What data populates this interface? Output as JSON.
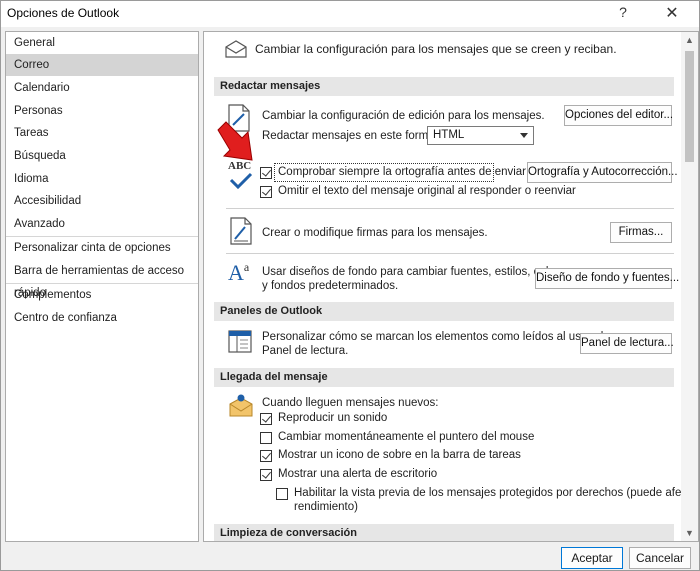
{
  "window": {
    "title": "Opciones de Outlook",
    "help_glyph": "?",
    "close_glyph": "✕"
  },
  "nav": {
    "items": [
      "General",
      "Correo",
      "Calendario",
      "Personas",
      "Tareas",
      "Búsqueda",
      "Idioma",
      "Accesibilidad",
      "Avanzado"
    ],
    "group2": [
      "Personalizar cinta de opciones",
      "Barra de herramientas de acceso rápido"
    ],
    "group3": [
      "Complementos",
      "Centro de confianza"
    ],
    "selected": "Correo"
  },
  "main": {
    "intro": "Cambiar la configuración para los mensajes que se creen y reciban.",
    "compose": {
      "header": "Redactar mensajes",
      "edit_text": "Cambiar la configuración de edición para los mensajes.",
      "editor_button": "Opciones del editor...",
      "format_label": "Redactar mensajes en este formato:",
      "format_value": "HTML",
      "spell_check": "Comprobar siempre la ortografía antes de enviar",
      "spell_button": "Ortografía y Autocorrección...",
      "omit_original": "Omitir el texto del mensaje original al responder o reenviar",
      "signatures_text": "Crear o modifique firmas para los mensajes.",
      "signatures_button": "Firmas...",
      "stationery_text_1": "Usar diseños de fondo para cambiar fuentes, estilos, colores",
      "stationery_text_2": "y fondos predeterminados.",
      "stationery_button": "Diseño de fondo y fuentes...",
      "abc_label": "ABC"
    },
    "panes": {
      "header": "Paneles de Outlook",
      "reading_text_1": "Personalizar cómo se marcan los elementos como leídos al usar el",
      "reading_text_2": "Panel de lectura.",
      "reading_button": "Panel de lectura..."
    },
    "arrival": {
      "header": "Llegada del mensaje",
      "intro": "Cuando lleguen mensajes nuevos:",
      "options": [
        {
          "label": "Reproducir un sonido",
          "checked": true
        },
        {
          "label": "Cambiar momentáneamente el puntero del mouse",
          "checked": false
        },
        {
          "label": "Mostrar un icono de sobre en la barra de tareas",
          "checked": true
        },
        {
          "label": "Mostrar una alerta de escritorio",
          "checked": true
        }
      ],
      "preview_1": "Habilitar la vista previa de los mensajes protegidos por derechos (puede afectar al",
      "preview_2": "rendimiento)"
    },
    "cleanup": {
      "header": "Limpieza de conversación"
    }
  },
  "footer": {
    "ok": "Aceptar",
    "cancel": "Cancelar"
  },
  "colors": {
    "accent": "#0078d7",
    "arrow": "#e01e1e",
    "check_blue": "#1f5fa8"
  }
}
